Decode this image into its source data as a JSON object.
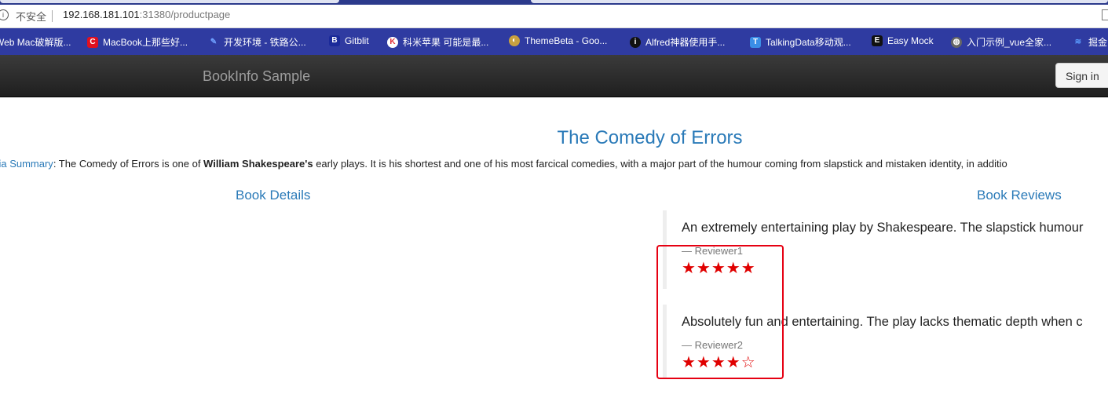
{
  "browser": {
    "security_label": "不安全",
    "url_host": "192.168.181.101",
    "url_rest": ":31380/productpage",
    "bookmarks": [
      {
        "label": "Web Mac破解版...",
        "icon": "globe-icon",
        "color": "#2f3ba1"
      },
      {
        "label": "MacBook上那些好...",
        "icon": "c-logo-icon",
        "color": "#e01020"
      },
      {
        "label": "开发环境 - 铁路公...",
        "icon": "pencil-icon",
        "color": "#3a6fd8"
      },
      {
        "label": "Gitblit",
        "icon": "gitblit-icon",
        "color": "#1b2a9a"
      },
      {
        "label": "科米苹果 可能是最...",
        "icon": "k-logo-icon",
        "color": "#e0303a"
      },
      {
        "label": "ThemeBeta - Goo...",
        "icon": "palette-icon",
        "color": "#c8a040"
      },
      {
        "label": "Alfred神器使用手...",
        "icon": "info-icon",
        "color": "#111111"
      },
      {
        "label": "TalkingData移动观...",
        "icon": "t-logo-icon",
        "color": "#3a8ee6"
      },
      {
        "label": "Easy Mock",
        "icon": "e-logo-icon",
        "color": "#111111"
      },
      {
        "label": "入门示例_vue全家...",
        "icon": "globe-icon",
        "color": "#666666"
      },
      {
        "label": "掘金",
        "icon": "juejin-icon",
        "color": "#1e80ff"
      }
    ]
  },
  "navbar": {
    "brand": "BookInfo Sample",
    "signin_label": "Sign in"
  },
  "product": {
    "title": "The Comedy of Errors",
    "summary_link": "edia Summary",
    "summary_prefix": ": The Comedy of Errors is one of ",
    "summary_bold": "William Shakespeare's",
    "summary_suffix": " early plays. It is his shortest and one of his most farcical comedies, with a major part of the humour coming from slapstick and mistaken identity, in additio"
  },
  "sections": {
    "details_heading": "Book Details",
    "reviews_heading": "Book Reviews"
  },
  "reviews": [
    {
      "text": "An extremely entertaining play by Shakespeare. The slapstick humour",
      "author": "— Reviewer1",
      "stars": "★★★★★",
      "rating": 5,
      "star_color": "#e00000"
    },
    {
      "text": "Absolutely fun and entertaining. The play lacks thematic depth when c",
      "author": "— Reviewer2",
      "stars": "★★★★☆",
      "rating": 4,
      "star_color": "#e00000"
    }
  ],
  "colors": {
    "link": "#2a7ab8",
    "highlight_box": "#e60012",
    "bookmarks_bar": "#2f3ba1"
  }
}
